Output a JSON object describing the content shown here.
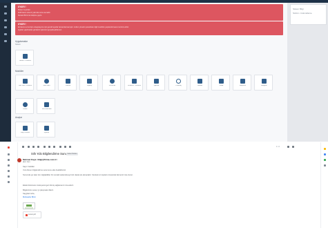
{
  "colors": {
    "alert": "#dd5660",
    "sidebar": "#1e2c3c",
    "accent": "#2f5d8a",
    "brand_red": "#ea4335"
  },
  "right_panel": {
    "title": "Sistem Bilgi",
    "line": "Sürüm • Güncelleme"
  },
  "alerts": [
    {
      "title": "UYARI !",
      "lines": [
        "Sistem Uyarıları",
        "Aktif lisans süreniz yakında sona erecektir.",
        "Destek Birimi ile iletişime geçin."
      ]
    },
    {
      "title": "UYARI !",
      "lines": [
        "E-Fatura ve E-Arşiv entegrasyonu için gerekli ayarlar tamamlanmamıştır. Lütfen yönetim panelinden ilgili modülün yapılandırmasını kontrol ediniz.",
        "Ayarlar yapılmadan gönderim işlemleri gerçekleştirilemez."
      ]
    }
  ],
  "sections": [
    {
      "title": "Uygulamalar",
      "subtitle": "Sistem",
      "tiles": [
        {
          "icon": "document-icon",
          "label": "Sistem Yönetimi"
        }
      ]
    },
    {
      "title": "Modüller",
      "tiles": [
        {
          "icon": "users-icon",
          "label": "Cari Kart Yönetimi"
        },
        {
          "icon": "box-icon",
          "label": "Stok Kartı"
        },
        {
          "icon": "invoice-icon",
          "label": "Fatura"
        },
        {
          "icon": "order-icon",
          "label": "Sipariş"
        },
        {
          "icon": "people-icon",
          "label": "Personel"
        },
        {
          "icon": "user-icon",
          "label": "Kullanıcı Yönetimi"
        },
        {
          "icon": "calendar-icon",
          "label": "Ajanda"
        },
        {
          "icon": "clock-icon",
          "label": "Puantaj"
        },
        {
          "icon": "bank-icon",
          "label": "Banka"
        },
        {
          "icon": "cash-icon",
          "label": "Kasa"
        },
        {
          "icon": "chart-icon",
          "label": "Raporlar"
        },
        {
          "icon": "file-icon",
          "label": "Belgeler"
        },
        {
          "icon": "pie-icon",
          "label": "Analiz"
        },
        {
          "icon": "table-icon",
          "label": "Tanımlamalar"
        }
      ]
    },
    {
      "title": "Araçlar",
      "tiles": [
        {
          "icon": "list-icon",
          "label": "Kayıt Listesi"
        },
        {
          "icon": "settings-icon",
          "label": "Ayarlar"
        }
      ]
    }
  ],
  "mail": {
    "page_indicator": "1 / 2",
    "subject": "Sıfır Kilo Bilgilendirme Sunumu",
    "label": "Gelen Kutusu",
    "sender": "Mehmet Kaya <bilgi@firma.com.tr>",
    "to": "alıcı: ben",
    "body": [
      "Sayın Yetkililer,",
      "Yeni dönem bilgilendirme sunumunu ekte bulabilirsiniz.",
      "Sunumda yer alan tüm değişiklikler bir sonraki toplantıda ayrıntılı olarak ele alınacaktır. Sorularınızı toplantı öncesinde iletmeniz rica olunur.",
      "Ekteki dokümanı inceleyerek geri dönüş sağlamanızı rica ederiz.",
      "Bilgilerinize sunar, iyi çalışmalar dileriz.",
      "Saygılarımızla,",
      "Muhasebe Birimi"
    ],
    "attachment": "sunum.pdf"
  }
}
